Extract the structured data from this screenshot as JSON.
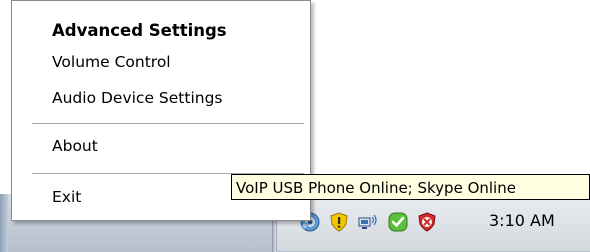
{
  "menu": {
    "items": [
      {
        "label": "Advanced Settings",
        "bold": true
      },
      {
        "label": "Volume Control"
      },
      {
        "label": "Audio Device Settings"
      },
      {
        "label": "About"
      },
      {
        "label": "Exit"
      }
    ]
  },
  "tooltip": {
    "text": "VoIP USB Phone Online; Skype Online"
  },
  "tray": {
    "icons": [
      "volume-speaker-icon",
      "security-shield-icon",
      "network-connection-icon",
      "skype-online-icon",
      "antivirus-shield-icon"
    ],
    "clock": "3:10 AM"
  },
  "colors": {
    "tooltip_bg": "#ffffe1",
    "menu_bg": "#ffffff",
    "tray_bg": "#dfe3e8"
  }
}
